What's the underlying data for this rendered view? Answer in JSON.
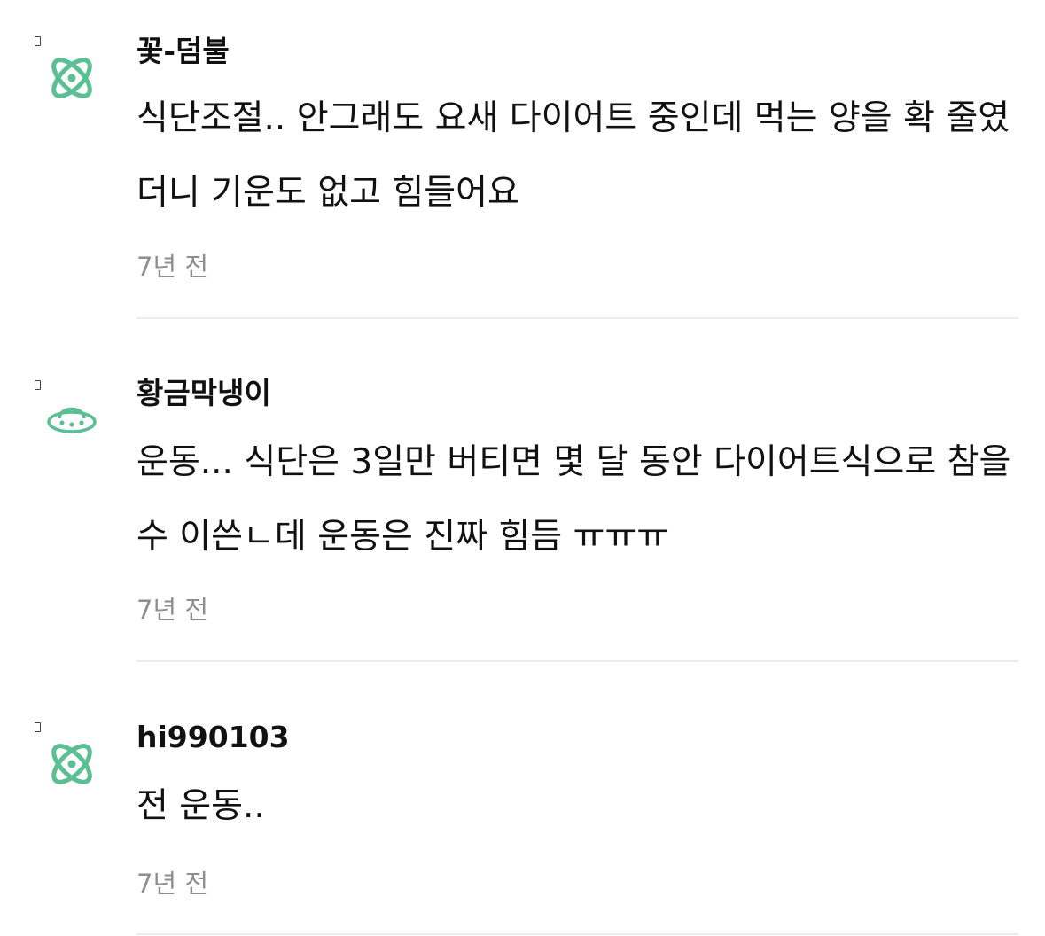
{
  "accent_color": "#5cbf94",
  "comments": [
    {
      "username": "꽃-덤불",
      "avatar_icon": "atom-icon",
      "text": "식단조절.. 안그래도 요새 다이어트 중인데 먹는 양을 확 줄였더니 기운도 없고 힘들어요",
      "time": "7년 전"
    },
    {
      "username": "황금막냉이",
      "avatar_icon": "ufo-icon",
      "text": "운동... 식단은 3일만 버티면 몇 달 동안 다이어트식으로 참을 수 이쓴ㄴ데 운동은 진짜 힘듬 ㅠㅠㅠ",
      "time": "7년 전"
    },
    {
      "username": "hi990103",
      "avatar_icon": "atom-icon",
      "text": "전 운동..",
      "time": "7년 전"
    }
  ]
}
